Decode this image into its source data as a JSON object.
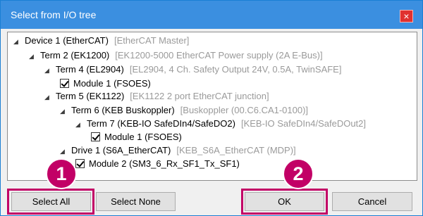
{
  "window": {
    "title": "Select from I/O tree",
    "close_glyph": "×"
  },
  "tree": [
    {
      "label": "Device 1 (EtherCAT)",
      "desc": "[EtherCAT Master]",
      "expander": "◢",
      "checkbox": false
    },
    {
      "label": "Term 2 (EK1200)",
      "desc": "[EK1200-5000 EtherCAT Power supply (2A E-Bus)]",
      "expander": "◢",
      "checkbox": false
    },
    {
      "label": "Term 4 (EL2904)",
      "desc": "[EL2904, 4 Ch. Safety Output 24V, 0.5A, TwinSAFE]",
      "expander": "◢",
      "checkbox": false
    },
    {
      "label": "Module 1 (FSOES)",
      "desc": "",
      "expander": "",
      "checkbox": true,
      "checked": true
    },
    {
      "label": "Term 5 (EK1122)",
      "desc": "[EK1122 2 port EtherCAT junction]",
      "expander": "◢",
      "checkbox": false
    },
    {
      "label": "Term 6 (KEB Buskoppler)",
      "desc": "[Buskoppler (00.C6.CA1-0100)]",
      "expander": "◢",
      "checkbox": false
    },
    {
      "label": "Term 7 (KEB-IO SafeDIn4/SafeDO2)",
      "desc": "[KEB-IO SafeDIn4/SafeDOut2]",
      "expander": "◢",
      "checkbox": false
    },
    {
      "label": "Module 1 (FSOES)",
      "desc": "",
      "expander": "",
      "checkbox": true,
      "checked": true
    },
    {
      "label": "Drive 1 (S6A_EtherCAT)",
      "desc": "[KEB_S6A_EtherCAT (MDP)]",
      "expander": "◢",
      "checkbox": false
    },
    {
      "label": "Module 2 (SM3_6_Rx_SF1_Tx_SF1)",
      "desc": "",
      "expander": "",
      "checkbox": true,
      "checked": true
    }
  ],
  "buttons": {
    "select_all": "Select All",
    "select_none": "Select None",
    "ok": "OK",
    "cancel": "Cancel"
  },
  "callouts": {
    "one": "1",
    "two": "2"
  },
  "colors": {
    "titlebar": "#3b8fe0",
    "highlight": "#c20066",
    "close": "#e0312f"
  }
}
